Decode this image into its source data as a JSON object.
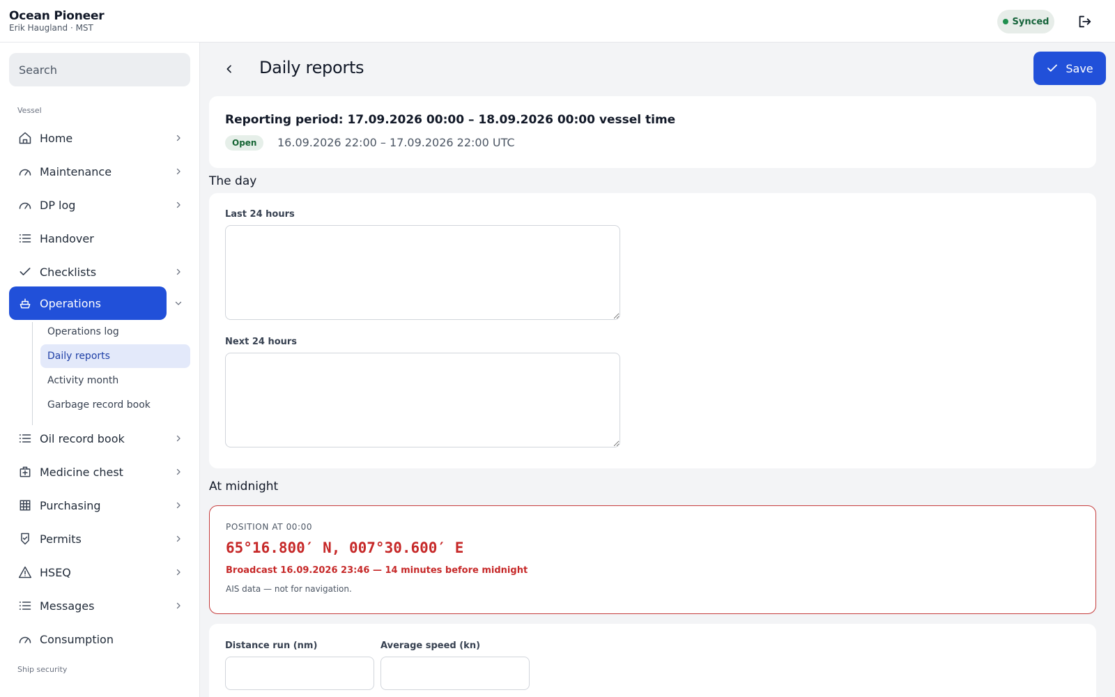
{
  "header": {
    "vessel_name": "Ocean Pioneer",
    "user_line": "Erik Haugland · MST",
    "sync_status": "Synced",
    "logout_icon": "logout-icon"
  },
  "sidebar": {
    "search_placeholder": "Search",
    "section_vessel": "Vessel",
    "section_ship_security": "Ship security",
    "items": [
      {
        "label": "Home",
        "icon": "home-icon",
        "expandable": true
      },
      {
        "label": "Maintenance",
        "icon": "gauge-icon",
        "expandable": true
      },
      {
        "label": "DP log",
        "icon": "gauge-icon",
        "expandable": true
      },
      {
        "label": "Handover",
        "icon": "list-icon",
        "expandable": false
      },
      {
        "label": "Checklists",
        "icon": "check-icon",
        "expandable": true
      },
      {
        "label": "Operations",
        "icon": "ship-icon",
        "expandable": true,
        "active": true,
        "expanded": true
      },
      {
        "label": "Oil record book",
        "icon": "list-icon",
        "expandable": true
      },
      {
        "label": "Medicine chest",
        "icon": "medkit-icon",
        "expandable": true
      },
      {
        "label": "Purchasing",
        "icon": "grid-icon",
        "expandable": true
      },
      {
        "label": "Permits",
        "icon": "shield-check-icon",
        "expandable": true
      },
      {
        "label": "HSEQ",
        "icon": "warning-icon",
        "expandable": true
      },
      {
        "label": "Messages",
        "icon": "list-icon",
        "expandable": true
      },
      {
        "label": "Consumption",
        "icon": "gauge-icon",
        "expandable": false
      }
    ],
    "operations_sub": [
      {
        "label": "Operations log"
      },
      {
        "label": "Daily reports",
        "active": true
      },
      {
        "label": "Activity month"
      },
      {
        "label": "Garbage record book"
      }
    ]
  },
  "main": {
    "title": "Daily reports",
    "save_label": "Save",
    "period": {
      "title": "Reporting period: 17.09.2026 00:00 – 18.09.2026 00:00 vessel time",
      "status_badge": "Open",
      "utc_range": "16.09.2026 22:00 – 17.09.2026 22:00 UTC"
    },
    "the_day": {
      "heading": "The day",
      "last_24_label": "Last 24 hours",
      "last_24_value": "",
      "next_24_label": "Next 24 hours",
      "next_24_value": ""
    },
    "at_midnight": {
      "heading": "At midnight",
      "position_label": "POSITION AT 00:00",
      "position_value": "65°16.800′ N, 007°30.600′ E",
      "broadcast": "Broadcast 16.09.2026 23:46 — 14 minutes before midnight",
      "note": "AIS data — not for navigation.",
      "alert_color": "#c62828"
    },
    "voyage": {
      "distance_label": "Distance run (nm)",
      "distance_value": "",
      "speed_label": "Average speed (kn)",
      "speed_value": ""
    }
  },
  "colors": {
    "accent": "#2150d9",
    "synced_bg": "#e7ede9",
    "alert": "#c53b3b"
  }
}
